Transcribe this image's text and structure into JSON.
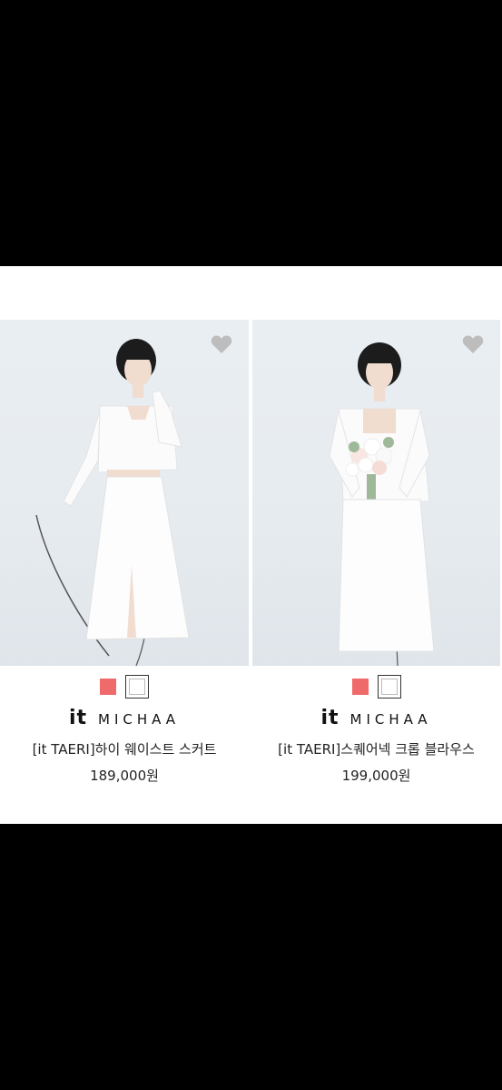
{
  "products": [
    {
      "brand_prefix": "it",
      "brand_name": "MICHAA",
      "name": "[it TAERI]하이 웨이스트 스커트",
      "price": "189,000원",
      "colors": [
        "#ef6a6a",
        "#ffffff"
      ],
      "wishlist_icon": "heart-icon"
    },
    {
      "brand_prefix": "it",
      "brand_name": "MICHAA",
      "name": "[it TAERI]스퀘어넥 크롭 블라우스",
      "price": "199,000원",
      "colors": [
        "#ef6a6a",
        "#ffffff"
      ],
      "wishlist_icon": "heart-icon"
    }
  ]
}
